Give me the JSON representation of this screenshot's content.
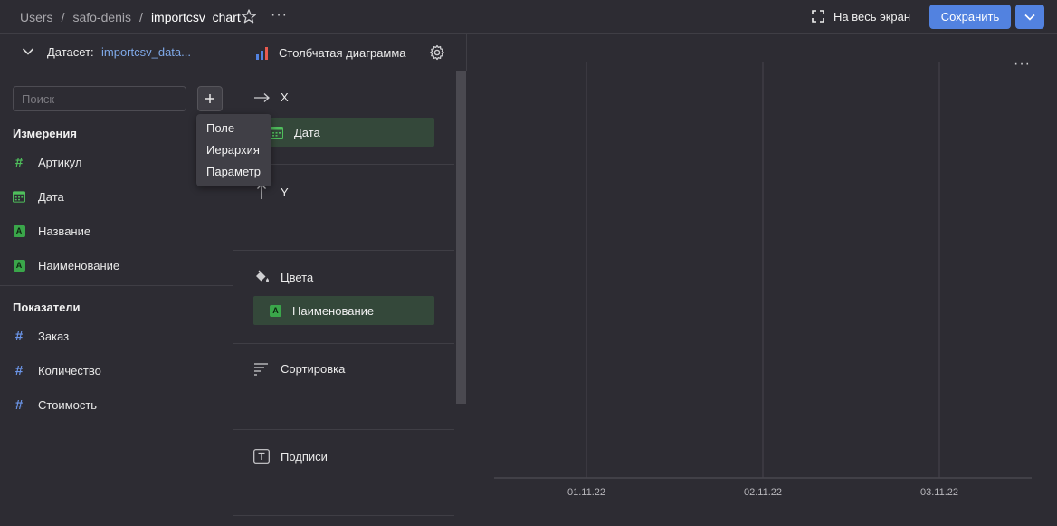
{
  "breadcrumbs": [
    "Users",
    "safo-denis",
    "importcsv_chart"
  ],
  "breadcrumb_sep": "/",
  "header": {
    "more_label": "···",
    "fullscreen_label": "На весь экран",
    "save_label": "Сохранить"
  },
  "dataset": {
    "label": "Датасет:",
    "name": "importcsv_data..."
  },
  "search": {
    "placeholder": "Поиск",
    "value": ""
  },
  "add_menu": {
    "items": [
      "Поле",
      "Иерархия",
      "Параметр"
    ]
  },
  "dimensions": {
    "title": "Измерения",
    "items": [
      {
        "label": "Артикул",
        "icon": "hash-icon"
      },
      {
        "label": "Дата",
        "icon": "calendar-icon"
      },
      {
        "label": "Название",
        "icon": "string-icon"
      },
      {
        "label": "Наименование",
        "icon": "string-icon"
      }
    ]
  },
  "measures": {
    "title": "Показатели",
    "items": [
      {
        "label": "Заказ",
        "icon": "hash-icon"
      },
      {
        "label": "Количество",
        "icon": "hash-icon"
      },
      {
        "label": "Стоимость",
        "icon": "hash-icon"
      }
    ]
  },
  "visualization": {
    "title": "Столбчатая диаграмма"
  },
  "sections": {
    "x": {
      "label": "X",
      "chip": "Дата"
    },
    "y": {
      "label": "Y"
    },
    "colors": {
      "label": "Цвета",
      "chip": "Наименование"
    },
    "sort": {
      "label": "Сортировка"
    },
    "labels": {
      "label": "Подписи"
    }
  },
  "chart_more": "···",
  "colors": {
    "accent": "#5282e0",
    "dimension": "#4fbf5c",
    "measure": "#6b95e8",
    "chip_bg": "#34483a"
  },
  "chart_data": {
    "type": "bar",
    "categories": [
      "01.11.22",
      "02.11.22",
      "03.11.22"
    ],
    "series": [],
    "grid": true
  }
}
